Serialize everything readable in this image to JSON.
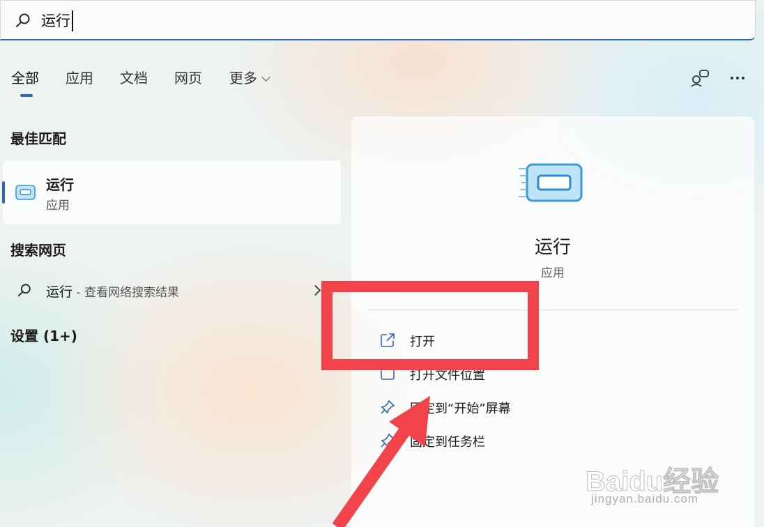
{
  "search": {
    "query": "运行"
  },
  "tabs": [
    {
      "label": "全部",
      "active": true
    },
    {
      "label": "应用"
    },
    {
      "label": "文档"
    },
    {
      "label": "网页"
    },
    {
      "label": "更多"
    }
  ],
  "toolbar": {
    "feedback_icon": "people-feedback-icon",
    "more_icon": "more-options-icon"
  },
  "sections": {
    "best_match": "最佳匹配",
    "search_web": "搜索网页",
    "settings": "设置 (1+)"
  },
  "best_match": {
    "name": "运行",
    "type": "应用"
  },
  "web_result": {
    "query": "运行",
    "suffix": " - 查看网络搜索结果"
  },
  "detail_panel": {
    "name": "运行",
    "type": "应用",
    "actions": [
      {
        "label": "打开",
        "icon": "open-external-icon"
      },
      {
        "label": "打开文件位置",
        "icon": "folder-icon"
      },
      {
        "label": "固定到“开始”屏幕",
        "icon": "pin-icon"
      },
      {
        "label": "固定到任务栏",
        "icon": "pin-icon"
      }
    ]
  },
  "annotation": {
    "color": "#f2434a"
  },
  "watermark": {
    "main": "Baidu经验",
    "sub": "jingyan.baidu.com"
  },
  "colors": {
    "accent": "#2f67b8"
  }
}
